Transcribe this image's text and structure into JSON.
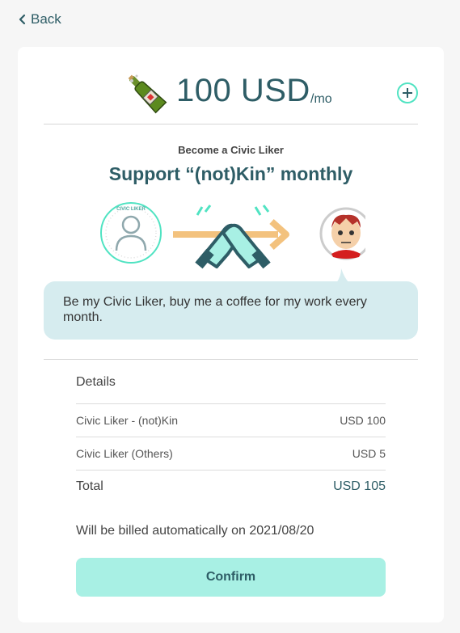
{
  "nav": {
    "back_label": "Back"
  },
  "price": {
    "amount": "100 USD",
    "period": "/mo"
  },
  "header": {
    "eyebrow": "Become a Civic Liker",
    "title": "Support “(not)Kin” monthly"
  },
  "illustration": {
    "badge_text": "CIVIC LIKER"
  },
  "message": "Be my Civic Liker, buy me a coffee for my work every month.",
  "details": {
    "title": "Details",
    "rows": [
      {
        "label": "Civic Liker - (not)Kin",
        "value": "USD 100"
      },
      {
        "label": "Civic Liker (Others)",
        "value": "USD 5"
      }
    ],
    "total": {
      "label": "Total",
      "value": "USD 105"
    }
  },
  "billing_note": "Will be billed automatically on 2021/08/20",
  "confirm_label": "Confirm",
  "colors": {
    "accent": "#50e3c2",
    "primary": "#2e5d66",
    "bubble": "#d6ecef",
    "button": "#a8f0e4",
    "arrow": "#f3c27e"
  }
}
